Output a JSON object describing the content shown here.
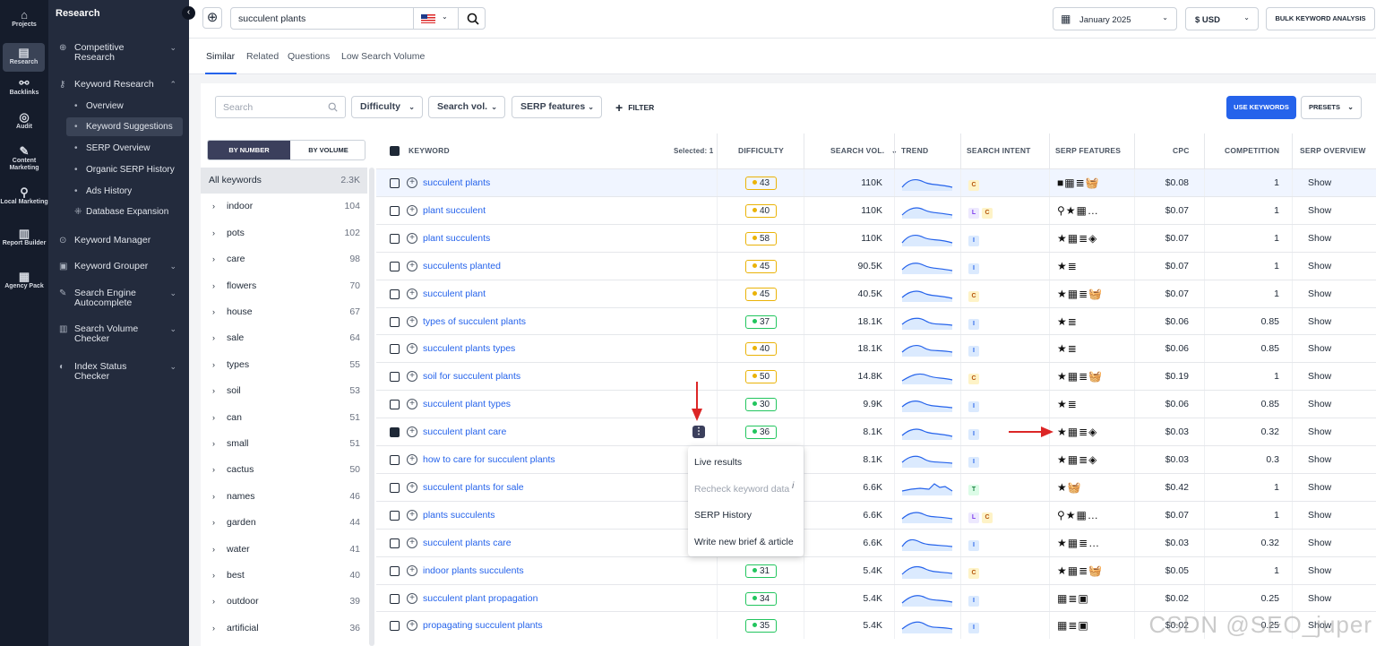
{
  "iconbar": [
    {
      "label": "Projects",
      "icon": "home-icon"
    },
    {
      "label": "Research",
      "icon": "research-icon"
    },
    {
      "label": "Backlinks",
      "icon": "link-icon"
    },
    {
      "label": "Audit",
      "icon": "audit-icon"
    },
    {
      "label": "Content Marketing",
      "icon": "pencil-icon"
    },
    {
      "label": "Local Marketing",
      "icon": "location-icon"
    },
    {
      "label": "Report Builder",
      "icon": "report-icon"
    },
    {
      "label": "Agency Pack",
      "icon": "building-icon"
    }
  ],
  "sidebar": {
    "title": "Research",
    "items": [
      {
        "label": "Competitive Research"
      },
      {
        "label": "Keyword Research"
      },
      {
        "label": "Keyword Manager"
      },
      {
        "label": "Keyword Grouper"
      },
      {
        "label": "Search Engine Autocomplete"
      },
      {
        "label": "Search Volume Checker"
      },
      {
        "label": "Index Status Checker"
      }
    ],
    "sub": [
      "Overview",
      "Keyword Suggestions",
      "SERP Overview",
      "Organic SERP History",
      "Ads History",
      "Database Expansion"
    ]
  },
  "topbar": {
    "search_value": "succulent plants",
    "date": "January 2025",
    "currency": "$ USD",
    "bulk": "BULK KEYWORD ANALYSIS"
  },
  "tabs": [
    "Similar",
    "Related",
    "Questions",
    "Low Search Volume"
  ],
  "filters": {
    "search_placeholder": "Search",
    "difficulty": "Difficulty",
    "search_vol": "Search vol.",
    "serp": "SERP features",
    "filter": "FILTER",
    "use_keywords": "USE KEYWORDS",
    "presets": "PRESETS"
  },
  "toggle": {
    "by_number": "BY NUMBER",
    "by_volume": "BY VOLUME"
  },
  "groups": [
    {
      "name": "All keywords",
      "count": "2.3K"
    },
    {
      "name": "indoor",
      "count": "104"
    },
    {
      "name": "pots",
      "count": "102"
    },
    {
      "name": "care",
      "count": "98"
    },
    {
      "name": "flowers",
      "count": "70"
    },
    {
      "name": "house",
      "count": "67"
    },
    {
      "name": "sale",
      "count": "64"
    },
    {
      "name": "types",
      "count": "55"
    },
    {
      "name": "soil",
      "count": "53"
    },
    {
      "name": "can",
      "count": "51"
    },
    {
      "name": "small",
      "count": "51"
    },
    {
      "name": "cactus",
      "count": "50"
    },
    {
      "name": "names",
      "count": "46"
    },
    {
      "name": "garden",
      "count": "44"
    },
    {
      "name": "water",
      "count": "41"
    },
    {
      "name": "best",
      "count": "40"
    },
    {
      "name": "outdoor",
      "count": "39"
    },
    {
      "name": "artificial",
      "count": "36"
    }
  ],
  "columns": {
    "keyword": "KEYWORD",
    "selected": "Selected: 1",
    "difficulty": "DIFFICULTY",
    "search_vol": "SEARCH VOL.",
    "trend": "TREND",
    "intent": "SEARCH INTENT",
    "serp": "SERP FEATURES",
    "cpc": "CPC",
    "competition": "COMPETITION",
    "overview": "SERP OVERVIEW"
  },
  "rows": [
    {
      "keyword": "succulent plants",
      "difficulty": "43",
      "volume": "110K",
      "intent": [
        "C"
      ],
      "features": "■▦≣🧺",
      "cpc": "$0.08",
      "competition": "1",
      "overview": "Show",
      "checked": false
    },
    {
      "keyword": "plant succulent",
      "difficulty": "40",
      "volume": "110K",
      "intent": [
        "L",
        "C"
      ],
      "features": "⚲★▦…",
      "cpc": "$0.07",
      "competition": "1",
      "overview": "Show",
      "checked": false
    },
    {
      "keyword": "plant succulents",
      "difficulty": "58",
      "volume": "110K",
      "intent": [
        "I"
      ],
      "features": "★▦≣◈",
      "cpc": "$0.07",
      "competition": "1",
      "overview": "Show",
      "checked": false
    },
    {
      "keyword": "succulents planted",
      "difficulty": "45",
      "volume": "90.5K",
      "intent": [
        "I"
      ],
      "features": "★≣",
      "cpc": "$0.07",
      "competition": "1",
      "overview": "Show",
      "checked": false
    },
    {
      "keyword": "succulent plant",
      "difficulty": "45",
      "volume": "40.5K",
      "intent": [
        "C"
      ],
      "features": "★▦≣🧺",
      "cpc": "$0.07",
      "competition": "1",
      "overview": "Show",
      "checked": false
    },
    {
      "keyword": "types of succulent plants",
      "difficulty": "37",
      "volume": "18.1K",
      "intent": [
        "I"
      ],
      "features": "★≣",
      "cpc": "$0.06",
      "competition": "0.85",
      "overview": "Show",
      "checked": false
    },
    {
      "keyword": "succulent plants types",
      "difficulty": "40",
      "volume": "18.1K",
      "intent": [
        "I"
      ],
      "features": "★≣",
      "cpc": "$0.06",
      "competition": "0.85",
      "overview": "Show",
      "checked": false
    },
    {
      "keyword": "soil for succulent plants",
      "difficulty": "50",
      "volume": "14.8K",
      "intent": [
        "C"
      ],
      "features": "★▦≣🧺",
      "cpc": "$0.19",
      "competition": "1",
      "overview": "Show",
      "checked": false
    },
    {
      "keyword": "succulent plant types",
      "difficulty": "30",
      "volume": "9.9K",
      "intent": [
        "I"
      ],
      "features": "★≣",
      "cpc": "$0.06",
      "competition": "0.85",
      "overview": "Show",
      "checked": false
    },
    {
      "keyword": "succulent plant care",
      "difficulty": "36",
      "volume": "8.1K",
      "intent": [
        "I"
      ],
      "features": "★▦≣◈",
      "cpc": "$0.03",
      "competition": "0.32",
      "overview": "Show",
      "checked": true
    },
    {
      "keyword": "how to care for succulent plants",
      "difficulty": "",
      "volume": "8.1K",
      "intent": [
        "I"
      ],
      "features": "★▦≣◈",
      "cpc": "$0.03",
      "competition": "0.3",
      "overview": "Show",
      "checked": false
    },
    {
      "keyword": "succulent plants for sale",
      "difficulty": "",
      "volume": "6.6K",
      "intent": [
        "T"
      ],
      "features": "★🧺",
      "cpc": "$0.42",
      "competition": "1",
      "overview": "Show",
      "checked": false
    },
    {
      "keyword": "plants succulents",
      "difficulty": "",
      "volume": "6.6K",
      "intent": [
        "L",
        "C"
      ],
      "features": "⚲★▦…",
      "cpc": "$0.07",
      "competition": "1",
      "overview": "Show",
      "checked": false
    },
    {
      "keyword": "succulent plants care",
      "difficulty": "",
      "volume": "6.6K",
      "intent": [
        "I"
      ],
      "features": "★▦≣…",
      "cpc": "$0.03",
      "competition": "0.32",
      "overview": "Show",
      "checked": false
    },
    {
      "keyword": "indoor plants succulents",
      "difficulty": "31",
      "volume": "5.4K",
      "intent": [
        "C"
      ],
      "features": "★▦≣🧺",
      "cpc": "$0.05",
      "competition": "1",
      "overview": "Show",
      "checked": false
    },
    {
      "keyword": "succulent plant propagation",
      "difficulty": "34",
      "volume": "5.4K",
      "intent": [
        "I"
      ],
      "features": "▦≣▣",
      "cpc": "$0.02",
      "competition": "0.25",
      "overview": "Show",
      "checked": false
    },
    {
      "keyword": "propagating succulent plants",
      "difficulty": "35",
      "volume": "5.4K",
      "intent": [
        "I"
      ],
      "features": "▦≣▣",
      "cpc": "$0.02",
      "competition": "0.25",
      "overview": "Show",
      "checked": false
    }
  ],
  "context_menu": [
    "Live results",
    "Recheck keyword data",
    "SERP History",
    "Write new brief & article"
  ],
  "watermark": "CSDN @SEO_juper",
  "colors": {
    "accent": "#2563eb",
    "easy": "#22c55e",
    "medium": "#eab308"
  }
}
